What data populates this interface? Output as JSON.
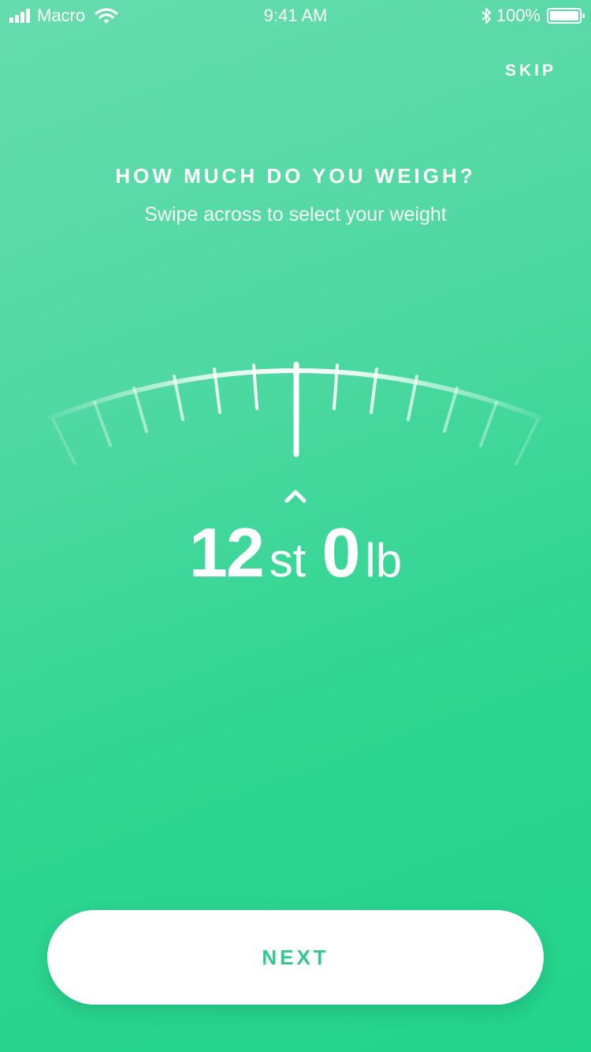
{
  "status_bar": {
    "carrier": "Macro",
    "time": "9:41 AM",
    "battery": "100%",
    "signal_icon": "signal-bars-icon",
    "wifi_icon": "wifi-icon",
    "bluetooth_icon": "bluetooth-icon"
  },
  "header": {
    "skip_label": "SKIP"
  },
  "question": {
    "title": "HOW MUCH DO YOU WEIGH?",
    "subtitle": "Swipe across to select your weight"
  },
  "weight": {
    "stones": "12",
    "stones_unit": "st",
    "pounds": "0",
    "pounds_unit": "lb"
  },
  "footer": {
    "next_label": "NEXT"
  },
  "colors": {
    "accent": "#2fc98b",
    "background_top": "#66dcae",
    "background_bottom": "#22d38c"
  }
}
